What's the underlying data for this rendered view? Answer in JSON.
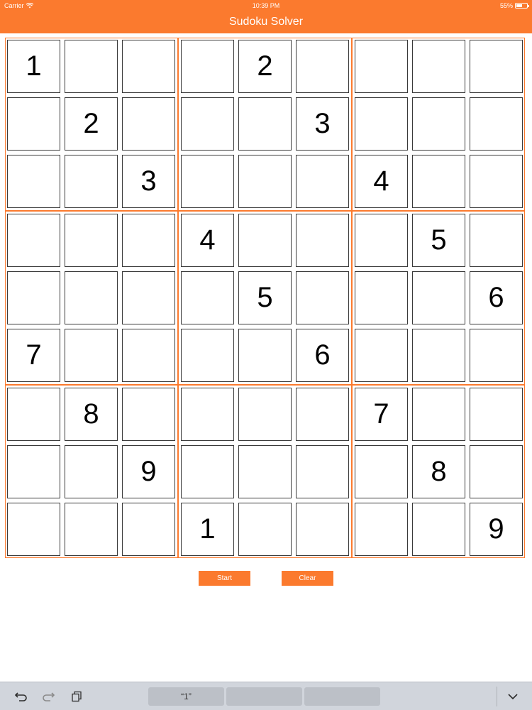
{
  "status_bar": {
    "carrier": "Carrier",
    "time": "10:39 PM",
    "battery_percent": "55%",
    "battery_level": 0.55
  },
  "nav": {
    "title": "Sudoku Solver"
  },
  "colors": {
    "accent": "#fb7a2e",
    "cell_border": "#3a3a3a",
    "keyboard_bar": "#d1d5dc"
  },
  "grid": [
    [
      "1",
      "",
      "",
      "",
      "2",
      "",
      "",
      "",
      ""
    ],
    [
      "",
      "2",
      "",
      "",
      "",
      "3",
      "",
      "",
      ""
    ],
    [
      "",
      "",
      "3",
      "",
      "",
      "",
      "4",
      "",
      ""
    ],
    [
      "",
      "",
      "",
      "4",
      "",
      "",
      "",
      "5",
      ""
    ],
    [
      "",
      "",
      "",
      "",
      "5",
      "",
      "",
      "",
      "6"
    ],
    [
      "7",
      "",
      "",
      "",
      "",
      "6",
      "",
      "",
      ""
    ],
    [
      "",
      "8",
      "",
      "",
      "",
      "",
      "7",
      "",
      ""
    ],
    [
      "",
      "",
      "9",
      "",
      "",
      "",
      "",
      "8",
      ""
    ],
    [
      "",
      "",
      "",
      "1",
      "",
      "",
      "",
      "",
      "9"
    ]
  ],
  "buttons": {
    "start": "Start",
    "clear": "Clear"
  },
  "keyboard_bar": {
    "suggestions": [
      "“1”",
      "",
      ""
    ],
    "icons": [
      "undo-icon",
      "redo-icon",
      "paste-icon",
      "hide-keyboard-icon"
    ]
  }
}
